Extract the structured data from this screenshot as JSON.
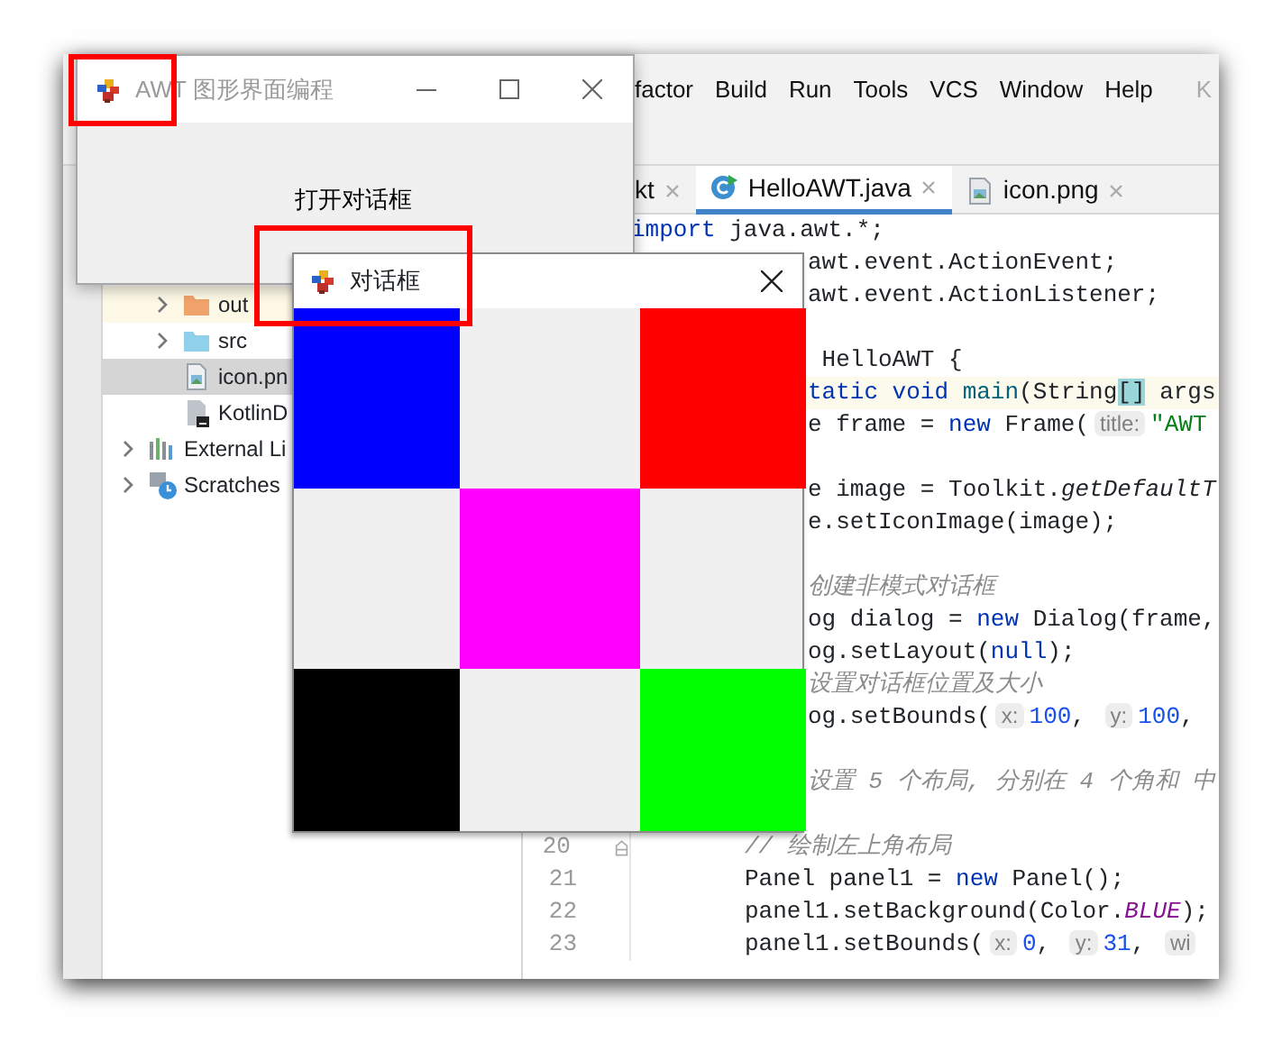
{
  "ide": {
    "menu": [
      "factor",
      "Build",
      "Run",
      "Tools",
      "VCS",
      "Window",
      "Help",
      "K"
    ],
    "editor_tabs": [
      {
        "label": "kt",
        "selected": false,
        "kind": "plain"
      },
      {
        "label": "HelloAWT.java",
        "selected": true,
        "kind": "java"
      },
      {
        "label": "icon.png",
        "selected": false,
        "kind": "image"
      }
    ],
    "project_tree": [
      {
        "children": [
          {
            "label": "out",
            "kind": "excluded-folder",
            "expanded": false,
            "selected": false
          },
          {
            "label": "src",
            "kind": "source-folder",
            "expanded": false,
            "selected": false
          },
          {
            "label": "icon.pn",
            "kind": "image-file",
            "selected": true
          },
          {
            "label": "KotlinD",
            "kind": "kotlin-file",
            "selected": false
          }
        ]
      },
      {
        "label": "External Li",
        "kind": "library",
        "expanded": false,
        "selected": false
      },
      {
        "label": "Scratches",
        "kind": "scratches",
        "expanded": false,
        "selected": false
      }
    ],
    "code_lines": [
      {
        "kind": "code",
        "current": false,
        "tokens": [
          {
            "kind": "keyword",
            "text": "import"
          },
          {
            "kind": "plain",
            "text": " java.awt.*;"
          }
        ]
      },
      {
        "kind": "code",
        "current": false,
        "tokens": [
          {
            "kind": "plain",
            "text": "awt.event.ActionEvent;"
          }
        ]
      },
      {
        "kind": "code",
        "current": false,
        "tokens": [
          {
            "kind": "plain",
            "text": "awt.event.ActionListener;"
          }
        ]
      },
      {
        "kind": "blank"
      },
      {
        "kind": "code",
        "current": false,
        "tokens": [
          {
            "kind": "plain",
            "text": " HelloAWT {"
          }
        ]
      },
      {
        "kind": "code",
        "current": true,
        "tokens": [
          {
            "kind": "keyword",
            "text": "tatic void "
          },
          {
            "kind": "declaration",
            "text": "main"
          },
          {
            "kind": "plain",
            "text": "(String"
          },
          {
            "kind": "match",
            "text": "[]"
          },
          {
            "kind": "plain",
            "text": " args"
          }
        ]
      },
      {
        "kind": "code",
        "current": false,
        "tokens": [
          {
            "kind": "plain",
            "text": "e frame = "
          },
          {
            "kind": "keyword",
            "text": "new"
          },
          {
            "kind": "plain",
            "text": " Frame("
          },
          {
            "kind": "hint",
            "text": "title:"
          },
          {
            "kind": "string",
            "text": "\"AWT"
          }
        ]
      },
      {
        "kind": "blank"
      },
      {
        "kind": "code",
        "current": false,
        "tokens": [
          {
            "kind": "plain",
            "text": "e image = Toolkit."
          },
          {
            "kind": "static",
            "text": "getDefaultT"
          }
        ]
      },
      {
        "kind": "code",
        "current": false,
        "tokens": [
          {
            "kind": "plain",
            "text": "e.setIconImage(image);"
          }
        ]
      },
      {
        "kind": "blank"
      },
      {
        "kind": "code",
        "current": false,
        "tokens": [
          {
            "kind": "comment",
            "text": "创建非模式对话框"
          }
        ]
      },
      {
        "kind": "code",
        "current": false,
        "tokens": [
          {
            "kind": "plain",
            "text": "og dialog = "
          },
          {
            "kind": "keyword",
            "text": "new"
          },
          {
            "kind": "plain",
            "text": " Dialog(frame,"
          }
        ]
      },
      {
        "kind": "code",
        "current": false,
        "tokens": [
          {
            "kind": "plain",
            "text": "og.setLayout("
          },
          {
            "kind": "keyword",
            "text": "null"
          },
          {
            "kind": "plain",
            "text": ");"
          }
        ]
      },
      {
        "kind": "code",
        "current": false,
        "tokens": [
          {
            "kind": "comment",
            "text": "设置对话框位置及大小"
          }
        ]
      },
      {
        "kind": "code",
        "current": false,
        "tokens": [
          {
            "kind": "plain",
            "text": "og.setBounds("
          },
          {
            "kind": "hint",
            "text": "x:"
          },
          {
            "kind": "number",
            "text": "100"
          },
          {
            "kind": "plain",
            "text": ", "
          },
          {
            "kind": "hint",
            "text": "y:"
          },
          {
            "kind": "number",
            "text": "100"
          },
          {
            "kind": "plain",
            "text": ","
          }
        ]
      },
      {
        "kind": "blank"
      },
      {
        "kind": "code",
        "current": false,
        "tokens": [
          {
            "kind": "comment",
            "text": "设置 5 个布局, 分别在 4 个角和 中"
          }
        ]
      },
      {
        "kind": "blank"
      },
      {
        "kind": "code",
        "number": "20",
        "fold": true,
        "tokens": [
          {
            "kind": "comment",
            "text": "// 绘制左上角布局"
          }
        ]
      },
      {
        "kind": "code",
        "number": "21",
        "tokens": [
          {
            "kind": "plain",
            "text": "Panel panel1 = "
          },
          {
            "kind": "keyword",
            "text": "new"
          },
          {
            "kind": "plain",
            "text": " Panel();"
          }
        ]
      },
      {
        "kind": "code",
        "number": "22",
        "tokens": [
          {
            "kind": "plain",
            "text": "panel1.setBackground(Color."
          },
          {
            "kind": "field",
            "text": "BLUE"
          },
          {
            "kind": "plain",
            "text": ");"
          }
        ]
      },
      {
        "kind": "code",
        "number": "23",
        "tokens": [
          {
            "kind": "plain",
            "text": "panel1.setBounds("
          },
          {
            "kind": "hint",
            "text": "x:"
          },
          {
            "kind": "number",
            "text": "0"
          },
          {
            "kind": "plain",
            "text": ", "
          },
          {
            "kind": "hint",
            "text": "y:"
          },
          {
            "kind": "number",
            "text": "31"
          },
          {
            "kind": "plain",
            "text": ", "
          },
          {
            "kind": "hint",
            "text": "wi"
          }
        ]
      }
    ]
  },
  "awt_frame": {
    "title": "AWT 图形界面编程",
    "active": false,
    "button": "打开对话框"
  },
  "dialog": {
    "title": "对话框",
    "panels": [
      {
        "kind": "top-left",
        "color": "#0000ff"
      },
      {
        "kind": "top-right",
        "color": "#ff0000"
      },
      {
        "kind": "center",
        "color": "#ff00ff"
      },
      {
        "kind": "bottom-left",
        "color": "#000000"
      },
      {
        "kind": "bottom-right",
        "color": "#00ff00"
      }
    ]
  },
  "annotations": [
    {
      "kind": "highlight-box"
    },
    {
      "kind": "highlight-box"
    }
  ]
}
